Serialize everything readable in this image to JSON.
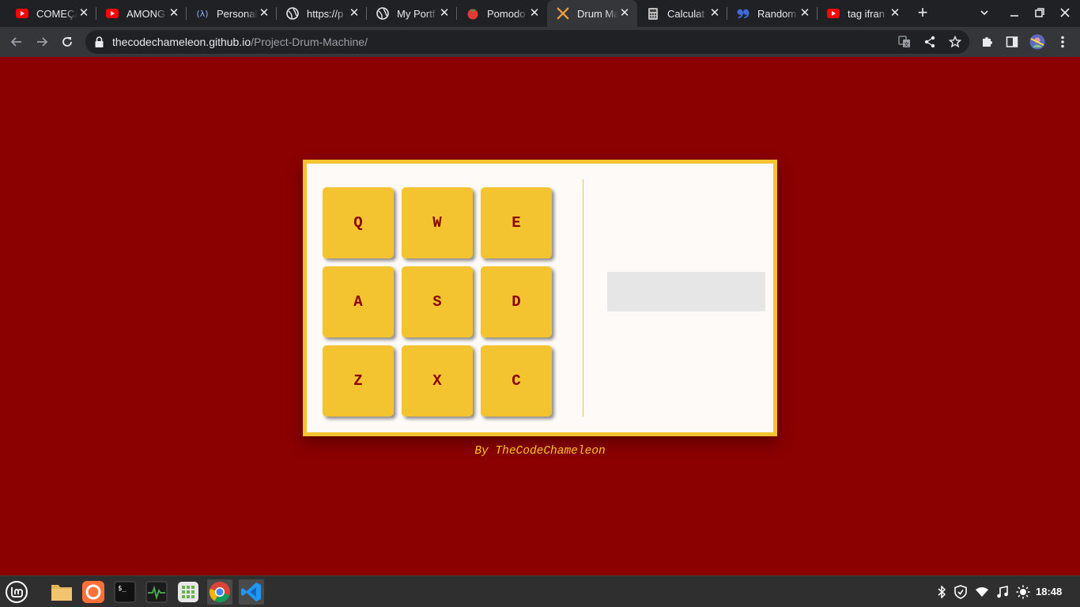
{
  "browser": {
    "tabs": [
      {
        "title": "COMEÇA",
        "icon": "youtube-icon"
      },
      {
        "title": "AMONG",
        "icon": "youtube-icon"
      },
      {
        "title": "Personal",
        "icon": "lambda-icon"
      },
      {
        "title": "https://p",
        "icon": "globe-icon"
      },
      {
        "title": "My Portf",
        "icon": "globe-icon"
      },
      {
        "title": "Pomodo",
        "icon": "tomato-icon"
      },
      {
        "title": "Drum Ma",
        "icon": "freecodecamp-icon",
        "active": true
      },
      {
        "title": "Calculat",
        "icon": "calculator-icon"
      },
      {
        "title": "Random",
        "icon": "quote-icon"
      },
      {
        "title": "tag ifran",
        "icon": "youtube-icon"
      }
    ],
    "new_tab_label": "+",
    "url_domain": "thecodechameleon.github.io",
    "url_path": "/Project-Drum-Machine/"
  },
  "drum_machine": {
    "pads": [
      "Q",
      "W",
      "E",
      "A",
      "S",
      "D",
      "Z",
      "X",
      "C"
    ],
    "display_text": ""
  },
  "credit": "By TheCodeChameleon",
  "taskbar": {
    "clock": "18:48"
  },
  "colors": {
    "background": "#8b0000",
    "accent": "#f4c430",
    "panel": "#fefaf8",
    "display": "#e6e6e6"
  }
}
